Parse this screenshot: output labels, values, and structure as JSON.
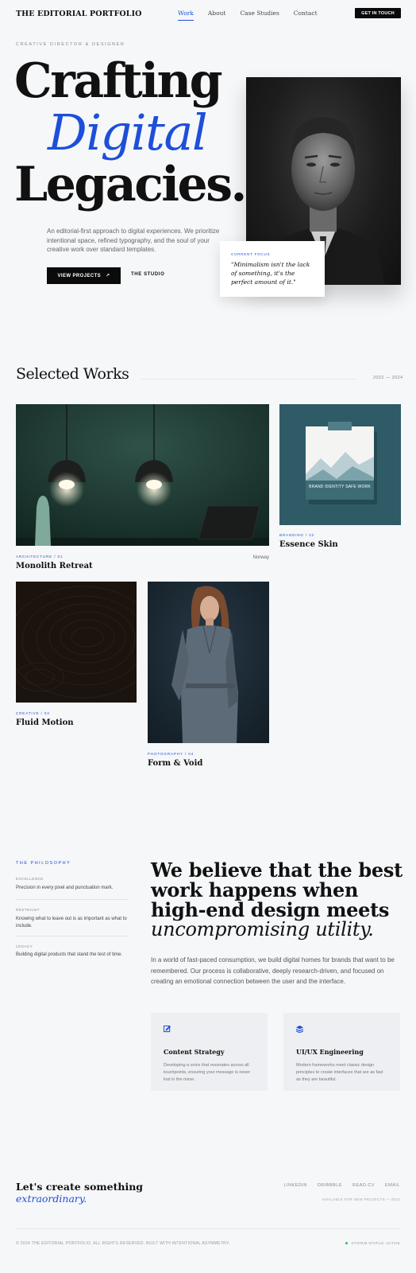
{
  "nav": {
    "brand": "THE EDITORIAL PORTFOLIO",
    "links": [
      "Work",
      "About",
      "Case Studies",
      "Contact"
    ],
    "cta": "GET IN TOUCH"
  },
  "hero": {
    "eyebrow": "CREATIVE DIRECTOR & DESIGNER",
    "line1": "Crafting",
    "line2": "Digital",
    "line3": "Legacies.",
    "subtitle": "An editorial-first approach to digital experiences. We prioritize intentional space, refined typography, and the soul of your creative work over standard templates.",
    "primary_btn": "VIEW PROJECTS",
    "secondary_link": "THE STUDIO",
    "quote_label": "CURRENT FOCUS",
    "quote": "\"Minimalism isn't the lack of something, it's the perfect amount of it.\""
  },
  "works": {
    "title": "Selected Works",
    "years": "2022 — 2024",
    "projects": [
      {
        "category": "ARCHITECTURE / 01",
        "title": "Monolith Retreat",
        "location": "Norway"
      },
      {
        "category": "BRANDING / 02",
        "title": "Essence Skin",
        "image_text": "BRAND IDENTITY SAFE WORK"
      },
      {
        "category": "CREATIVE / 03",
        "title": "Fluid Motion"
      },
      {
        "category": "PHOTOGRAPHY / 04",
        "title": "Form & Void"
      }
    ]
  },
  "philosophy": {
    "label": "THE PHILOSOPHY",
    "principles": [
      {
        "key": "EXCELLENCE",
        "value": "Precision in every pixel and punctuation mark."
      },
      {
        "key": "RESTRAINT",
        "value": "Knowing what to leave out is as important as what to include."
      },
      {
        "key": "LEGACY",
        "value": "Building digital products that stand the test of time."
      }
    ],
    "headline": "We believe that the best work happens when high-end design meets",
    "headline_italic": "uncompromising utility.",
    "body": "In a world of fast-paced consumption, we build digital homes for brands that want to be remembered. Our process is collaborative, deeply research-driven, and focused on creating an emotional connection between the user and the interface.",
    "services": [
      {
        "icon": "edit-icon",
        "title": "Content Strategy",
        "body": "Developing a voice that resonates across all touchpoints, ensuring your message is never lost in the noise."
      },
      {
        "icon": "layers-icon",
        "title": "UI/UX Engineering",
        "body": "Modern frameworks meet classic design principles to create interfaces that are as fast as they are beautiful."
      }
    ]
  },
  "footer": {
    "cta_line1": "Let's create something",
    "cta_line2": "extraordinary.",
    "links": [
      "LINKEDIN",
      "DRIBBBLE",
      "READ.CV",
      "EMAIL"
    ],
    "availability": "AVAILABLE FOR NEW PROJECTS — 2024",
    "copyright": "© 2024 THE EDITORIAL PORTFOLIO. ALL RIGHTS RESERVED. BUILT WITH INTENTIONAL ASYMMETRY.",
    "status": "SYSTEM STATUS: ACTIVE",
    "colors": {
      "accent": "#1d4fd8",
      "dark": "#0b0b0b",
      "status": "#22c55e"
    }
  }
}
